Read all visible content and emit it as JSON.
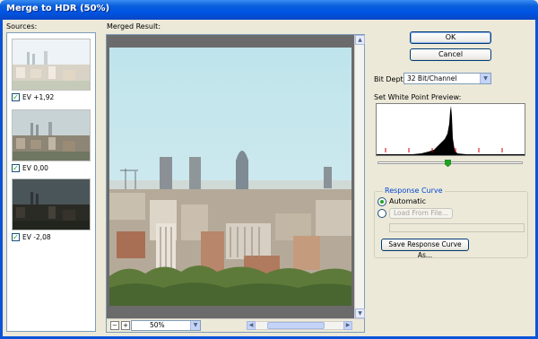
{
  "window": {
    "title": "Merge to HDR (50%)"
  },
  "sources": {
    "label": "Sources:",
    "items": [
      {
        "caption": "EV +1,92",
        "checked": true,
        "tone": "bright"
      },
      {
        "caption": "EV 0,00",
        "checked": true,
        "tone": "normal"
      },
      {
        "caption": "EV -2,08",
        "checked": true,
        "tone": "dark"
      }
    ]
  },
  "merged": {
    "label": "Merged Result:",
    "zoom": "50%"
  },
  "buttons": {
    "ok": "OK",
    "cancel": "Cancel"
  },
  "bit_depth": {
    "label": "Bit Depth:",
    "value": "32 Bit/Channel"
  },
  "white_point": {
    "label": "Set White Point Preview:",
    "level": 0.5
  },
  "response_curve": {
    "title": "Response Curve",
    "automatic": "Automatic",
    "load_button": "Load From File...",
    "save_button": "Save Response Curve As..."
  },
  "colors": {
    "title_bar": "#0055e5",
    "accent_green": "#21a121",
    "group_title": "#0046d5"
  }
}
